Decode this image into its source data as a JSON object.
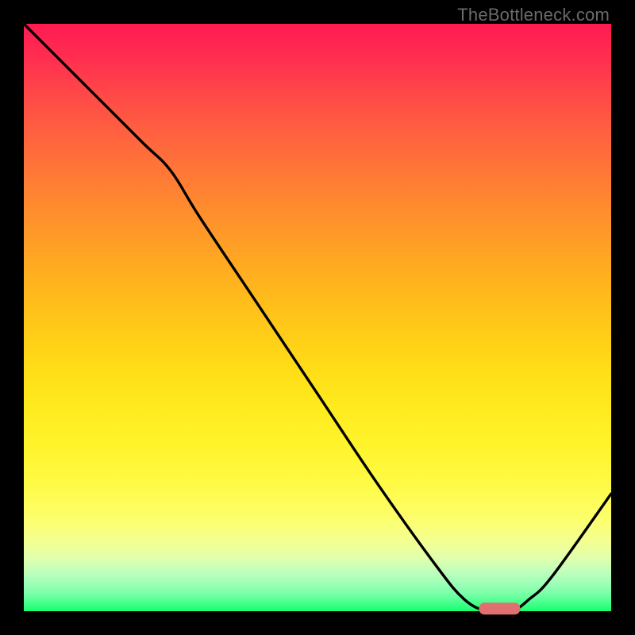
{
  "watermark": "TheBottleneck.com",
  "chart_data": {
    "type": "line",
    "title": "",
    "xlabel": "",
    "ylabel": "",
    "xlim": [
      0,
      100
    ],
    "ylim": [
      0,
      100
    ],
    "grid": false,
    "legend": false,
    "series": [
      {
        "name": "bottleneck-curve",
        "color": "#000000",
        "type": "line",
        "x": [
          0,
          10,
          20,
          25,
          30,
          40,
          50,
          60,
          70,
          75,
          79,
          83,
          86,
          90,
          100
        ],
        "y": [
          100,
          90,
          80,
          75,
          67,
          52,
          37,
          22,
          8,
          2,
          0,
          0,
          2,
          6,
          20
        ]
      },
      {
        "name": "optimal-marker",
        "color": "#e07070",
        "type": "marker",
        "x": [
          81
        ],
        "y": [
          0.5
        ]
      }
    ],
    "annotations": []
  }
}
